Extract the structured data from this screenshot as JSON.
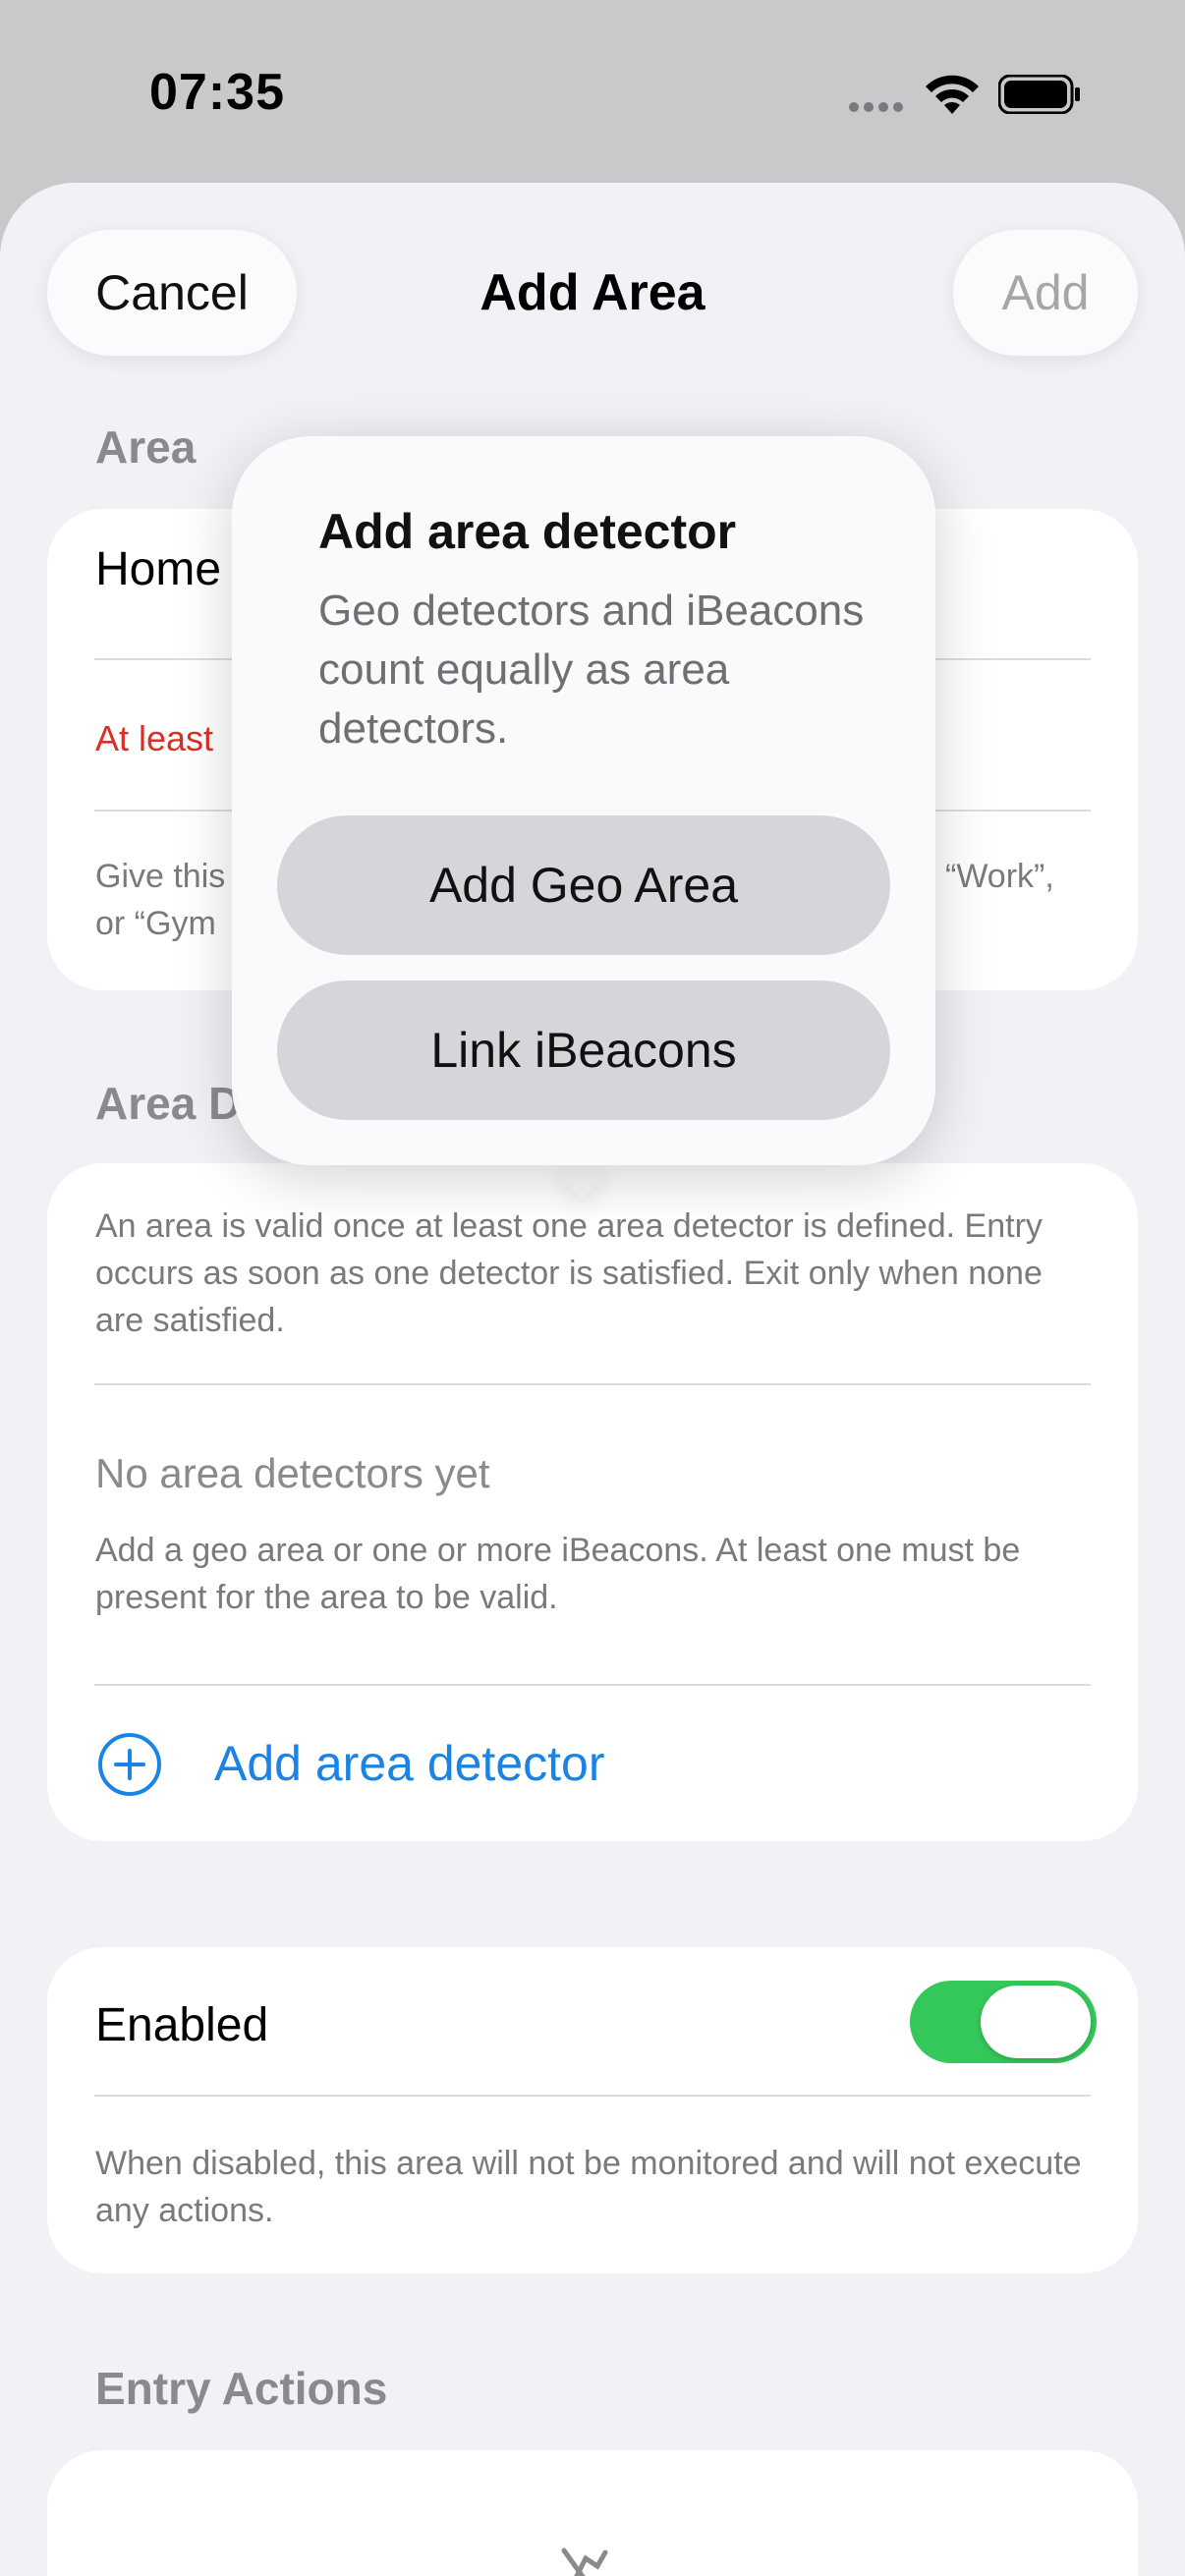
{
  "status": {
    "time": "07:35"
  },
  "nav": {
    "cancel": "Cancel",
    "title": "Add Area",
    "add": "Add"
  },
  "area": {
    "header": "Area",
    "name_value": "Home",
    "error_text": "At least",
    "hint_left": "Give this",
    "hint_left2": "or “Gym",
    "hint_right": "“Work”,"
  },
  "detectors": {
    "header": "Area D",
    "info": "An area is valid once at least one area detector is defined. Entry occurs as soon as one detector is satisfied. Exit only when none are satisfied.",
    "empty_title": "No area detectors yet",
    "empty_desc": "Add a geo area or one or more iBeacons. At least one must be present for the area to be valid.",
    "add_label": "Add area detector"
  },
  "enabled": {
    "label": "Enabled",
    "on": true,
    "desc": "When disabled, this area will not be monitored and will not execute any actions."
  },
  "entry_actions": {
    "header": "Entry Actions"
  },
  "popover": {
    "title": "Add area detector",
    "desc": "Geo detectors and iBeacons count equally as area detectors.",
    "geo_button": "Add Geo Area",
    "ibeacon_button": "Link iBeacons"
  },
  "colors": {
    "accent": "#1a84e6",
    "error": "#d93025",
    "toggle_on": "#34c759"
  }
}
